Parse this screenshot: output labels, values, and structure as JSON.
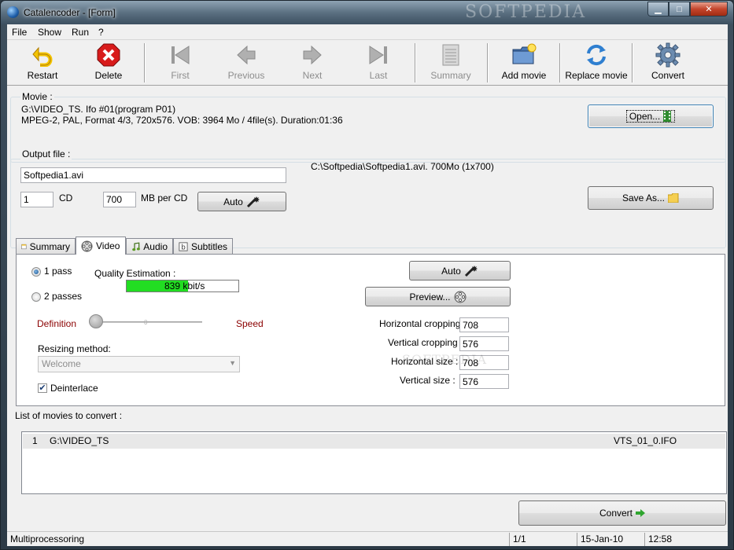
{
  "window": {
    "title": "Catalencoder - [Form]",
    "minimize_glyph": "▁",
    "maximize_glyph": "□",
    "close_glyph": "✕",
    "watermark": "SOFTPEDIA"
  },
  "menu": [
    "File",
    "Show",
    "Run",
    "?"
  ],
  "toolbar": {
    "restart": "Restart",
    "delete": "Delete",
    "first": "First",
    "previous": "Previous",
    "next": "Next",
    "last": "Last",
    "summary": "Summary",
    "add_movie": "Add movie",
    "replace_movie": "Replace movie",
    "convert": "Convert"
  },
  "movie": {
    "label": "Movie :",
    "line1": "G:\\VIDEO_TS. Ifo #01(program P01)",
    "line2": "MPEG-2,  PAL, Format 4/3, 720x576. VOB: 3964 Mo / 4file(s). Duration:01:36",
    "open_button": "Open..."
  },
  "output": {
    "label": "Output file :",
    "filename": "Softpedia1.avi",
    "info": "C:\\Softpedia\\Softpedia1.avi. 700Mo (1x700)",
    "cd_count": "1",
    "cd_label": "CD",
    "mb_per_cd": "700",
    "mb_label": "MB per CD",
    "auto_button": "Auto",
    "save_as_button": "Save As..."
  },
  "tabs": [
    "Summary",
    "Video",
    "Audio",
    "Subtitles"
  ],
  "video": {
    "one_pass": "1 pass",
    "two_passes": "2 passes",
    "quality_label": "Quality Estimation :",
    "quality_value": "839 kbit/s",
    "quality_fill_percent": 55,
    "definition": "Definition",
    "speed": "Speed",
    "slider_position": 0.0,
    "resizing_label": "Resizing method:",
    "resizing_value": "Welcome",
    "deinterlace": "Deinterlace",
    "deinterlace_checked": true,
    "auto_button": "Auto",
    "preview_button": "Preview...",
    "h_crop_label": "Horizontal cropping :",
    "h_crop_value": "708",
    "v_crop_label": "Vertical cropping :",
    "v_crop_value": "576",
    "h_size_label": "Horizontal size :",
    "h_size_value": "708",
    "v_size_label": "Vertical size :",
    "v_size_value": "576",
    "watermark": "SOFTPEDIA"
  },
  "list": {
    "label": "List of movies to convert :",
    "rows": [
      {
        "index": "1",
        "path": "G:\\VIDEO_TS",
        "file": "VTS_01_0.IFO"
      }
    ]
  },
  "convert_button": "Convert",
  "status": {
    "mode": "Multiprocessoring",
    "page": "1/1",
    "date": "15-Jan-10",
    "time": "12:58"
  },
  "colors": {
    "quality_bar": "#22dd22",
    "accent_red": "#8b0000",
    "title_gradient": "#5b7081"
  }
}
